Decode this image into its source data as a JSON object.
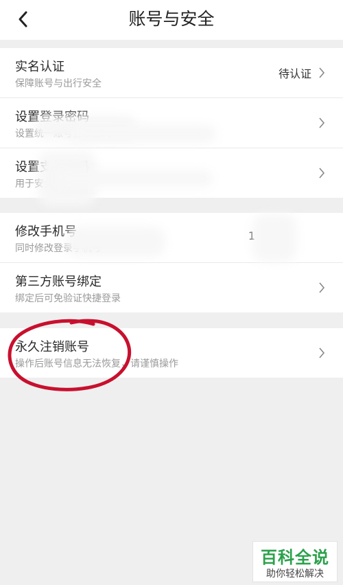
{
  "header": {
    "title": "账号与安全"
  },
  "groups": [
    {
      "rows": [
        {
          "title": "实名认证",
          "subtitle": "保障账号与出行安全",
          "value": "待认证"
        },
        {
          "title": "设置登录密码",
          "subtitle": "设置统一账号登录密码"
        },
        {
          "title": "设置支付密码",
          "subtitle": "用于安全验证"
        }
      ]
    },
    {
      "rows": [
        {
          "title": "修改手机号",
          "subtitle": "同时修改登录手机号",
          "value": "1"
        },
        {
          "title": "第三方账号绑定",
          "subtitle": "绑定后可免验证快捷登录"
        }
      ]
    },
    {
      "rows": [
        {
          "title": "永久注销账号",
          "subtitle": "操作后账号信息无法恢复，请谨慎操作"
        }
      ]
    }
  ],
  "watermark": {
    "brand": "百科全说",
    "sub": "助你轻松解决"
  },
  "colors": {
    "annotation_circle": "#c8102e",
    "watermark_brand": "#2aa14b"
  }
}
